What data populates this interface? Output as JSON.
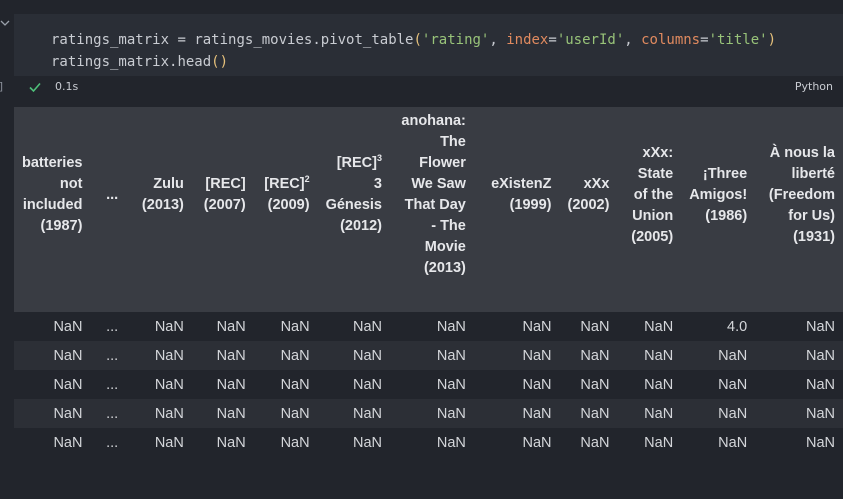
{
  "cell": {
    "execution_count": "]",
    "code_line1": [
      "ratings_matrix",
      " = ",
      "ratings_movies",
      ".",
      "pivot_table",
      "(",
      "'rating'",
      ", ",
      "index",
      "=",
      "'userId'",
      ", ",
      "columns",
      "=",
      "'title'",
      ")"
    ],
    "code_line2": [
      "ratings_matrix",
      ".",
      "head",
      "()"
    ],
    "exec_time": "0.1s",
    "language": "Python"
  },
  "table": {
    "columns": [
      {
        "parts": [
          "batteries",
          "not",
          "included",
          "(1987)"
        ]
      },
      {
        "parts": [
          "..."
        ]
      },
      {
        "parts": [
          "Zulu",
          "(2013)"
        ]
      },
      {
        "parts": [
          "[REC]",
          "(2007)"
        ]
      },
      {
        "label": "[REC]",
        "sup": "2",
        "year": "(2009)"
      },
      {
        "label": "[REC]",
        "sup": "3",
        "rest": [
          "3",
          "Génesis",
          "(2012)"
        ]
      },
      {
        "parts": [
          "anohana:",
          "The",
          "Flower",
          "We Saw",
          "That Day",
          "- The",
          "Movie",
          "(2013)"
        ]
      },
      {
        "parts": [
          "eXistenZ",
          "(1999)"
        ]
      },
      {
        "parts": [
          "xXx",
          "(2002)"
        ]
      },
      {
        "parts": [
          "xXx:",
          "State",
          "of the",
          "Union",
          "(2005)"
        ]
      },
      {
        "parts": [
          "¡Three",
          "Amigos!",
          "(1986)"
        ]
      },
      {
        "parts": [
          "À nous la",
          "liberté",
          "(Freedom",
          "for Us)",
          "(1931)"
        ]
      }
    ],
    "rows": [
      [
        "NaN",
        "...",
        "NaN",
        "NaN",
        "NaN",
        "NaN",
        "NaN",
        "NaN",
        "NaN",
        "NaN",
        "4.0",
        "NaN"
      ],
      [
        "NaN",
        "...",
        "NaN",
        "NaN",
        "NaN",
        "NaN",
        "NaN",
        "NaN",
        "NaN",
        "NaN",
        "NaN",
        "NaN"
      ],
      [
        "NaN",
        "...",
        "NaN",
        "NaN",
        "NaN",
        "NaN",
        "NaN",
        "NaN",
        "NaN",
        "NaN",
        "NaN",
        "NaN"
      ],
      [
        "NaN",
        "...",
        "NaN",
        "NaN",
        "NaN",
        "NaN",
        "NaN",
        "NaN",
        "NaN",
        "NaN",
        "NaN",
        "NaN"
      ],
      [
        "NaN",
        "...",
        "NaN",
        "NaN",
        "NaN",
        "NaN",
        "NaN",
        "NaN",
        "NaN",
        "NaN",
        "NaN",
        "NaN"
      ]
    ]
  },
  "icons": {
    "collapse": "chevron-down-icon",
    "status": "check-icon"
  },
  "colors": {
    "background": "#22252c",
    "code_cell_bg": "#2a2e36",
    "header_bg": "#393c43",
    "success": "#4ec07a",
    "string": "#98c379",
    "keyword_arg": "#e08a5f",
    "paren": "#e5c07b"
  }
}
